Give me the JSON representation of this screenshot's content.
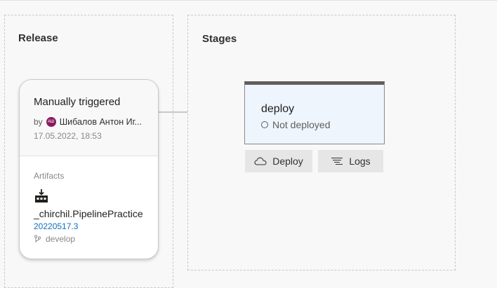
{
  "release": {
    "title": "Release",
    "card": {
      "trigger": "Manually triggered",
      "by_label": "by",
      "avatar_initials": "АШ",
      "user": "Шибалов Антон Иг...",
      "date": "17.05.2022, 18:53",
      "artifacts_label": "Artifacts",
      "artifact_name": "_chirchil.PipelinePractice",
      "artifact_version": "20220517.3",
      "branch": "develop"
    }
  },
  "stages": {
    "title": "Stages",
    "stage": {
      "name": "deploy",
      "status": "Not deployed"
    },
    "deploy_button": "Deploy",
    "logs_button": "Logs"
  },
  "colors": {
    "avatar": "#8a1a5f",
    "link": "#106ebe",
    "stage_bg": "#eef5fd"
  },
  "icons": {
    "artifact": "build-artifact-icon",
    "branch": "branch-icon",
    "status": "not-deployed-circle-icon",
    "deploy": "cloud-icon",
    "logs": "logs-icon"
  }
}
